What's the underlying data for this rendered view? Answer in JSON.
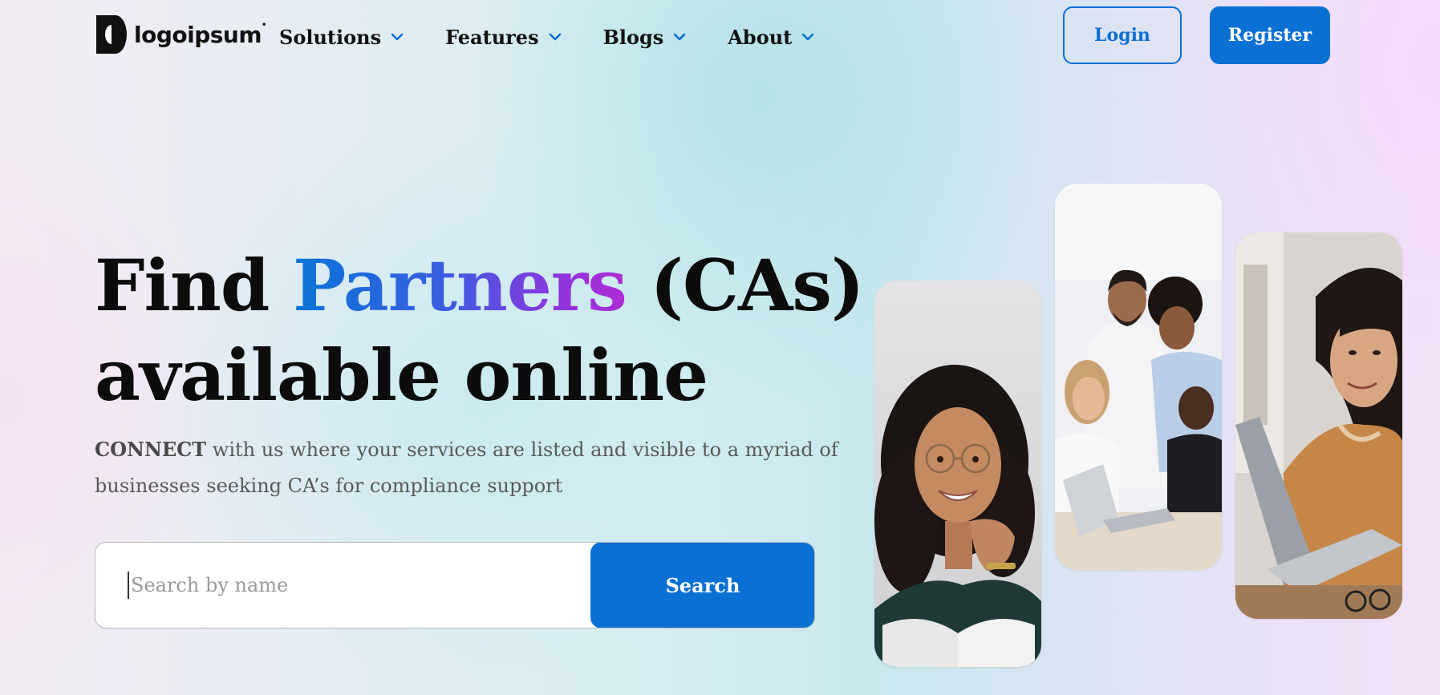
{
  "header": {
    "logo": {
      "name": "logoipsum",
      "mark": "logo-mark-icon"
    },
    "nav": [
      {
        "label": "Solutions",
        "icon": "chevron-down-icon"
      },
      {
        "label": "Features",
        "icon": "chevron-down-icon"
      },
      {
        "label": "Blogs",
        "icon": "chevron-down-icon"
      },
      {
        "label": "About",
        "icon": "chevron-down-icon"
      }
    ],
    "login_label": "Login",
    "register_label": "Register"
  },
  "hero": {
    "title_part1": "Find ",
    "title_highlight": "Partners",
    "title_part2": " (CAs)",
    "title_line2": "available online",
    "subtitle_bold": "CONNECT",
    "subtitle_rest": " with us where your services are listed and visible to a myriad of businesses seeking CA’s for compliance support",
    "search": {
      "placeholder": "Search by name",
      "value": "",
      "button_label": "Search"
    }
  },
  "images": [
    {
      "name": "woman-smiling-photo"
    },
    {
      "name": "team-meeting-photo"
    },
    {
      "name": "woman-laptop-photo"
    }
  ],
  "colors": {
    "accent": "#0b70d4",
    "gradient_start": "#0a74d6",
    "gradient_end": "#b02bd4",
    "heading": "#0c0c0c",
    "subtitle": "#5a5a5a"
  }
}
